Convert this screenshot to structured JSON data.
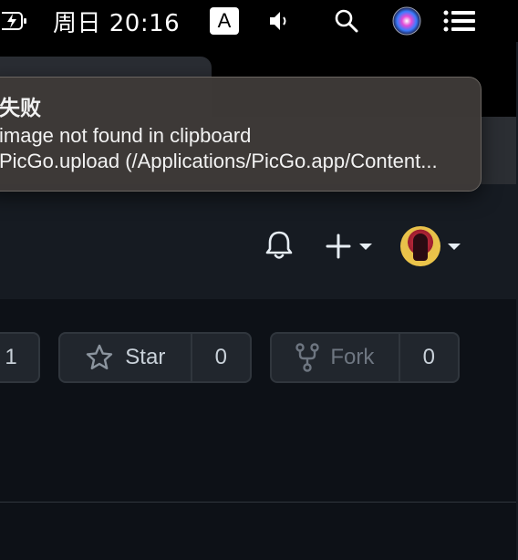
{
  "menubar": {
    "clock": "周日 20:16",
    "input_source": "A"
  },
  "notification": {
    "title": "失败",
    "line1": "image not found in clipboard",
    "line2": "PicGo.upload (/Applications/PicGo.app/Content..."
  },
  "repo_actions": {
    "watch_count": "1",
    "star_label": "Star",
    "star_count": "0",
    "fork_label": "Fork",
    "fork_count": "0"
  },
  "colors": {
    "menubar_bg": "#000000",
    "header_bg": "#161b22",
    "content_bg": "#0d1117",
    "button_bg": "#21262d",
    "banner_bg": "#3e3a38"
  },
  "icons": [
    "battery-charging-icon",
    "volume-icon",
    "search-icon",
    "siri-icon",
    "notification-center-icon",
    "bell-icon",
    "plus-icon",
    "star-icon",
    "fork-icon"
  ]
}
